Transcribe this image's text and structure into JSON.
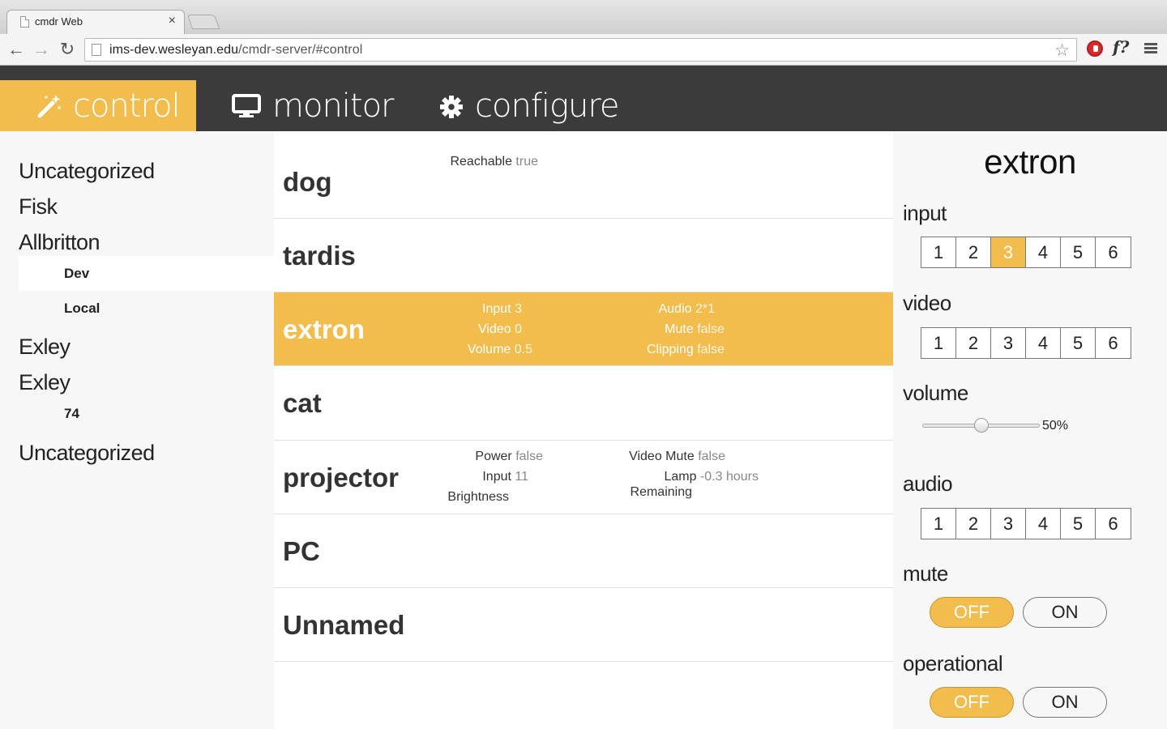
{
  "browser": {
    "tab_title": "cmdr Web",
    "close_glyph": "×",
    "url_host": "ims-dev.wesleyan.edu",
    "url_path": "/cmdr-server/#control",
    "back_glyph": "←",
    "forward_glyph": "→",
    "reload_glyph": "↻",
    "star_glyph": "☆",
    "ext_f_label": "f?"
  },
  "nav": {
    "tabs": [
      {
        "label": "control",
        "icon": "magic-wand-icon",
        "active": true
      },
      {
        "label": "monitor",
        "icon": "monitor-icon",
        "active": false
      },
      {
        "label": "configure",
        "icon": "gear-icon",
        "active": false
      }
    ],
    "accent_color": "#f2bd4d",
    "bar_color": "#3b3b3c"
  },
  "sidebar": {
    "items": [
      {
        "label": "Uncategorized"
      },
      {
        "label": "Fisk"
      },
      {
        "label": "Allbritton",
        "children": [
          "Dev",
          "Local"
        ],
        "selected_child": "Dev"
      },
      {
        "label": "Exley"
      },
      {
        "label": "Exley",
        "children": [
          "74"
        ]
      },
      {
        "label": "Uncategorized"
      }
    ]
  },
  "devices": [
    {
      "name": "dog",
      "props": [
        {
          "k": "Reachable",
          "v": "true"
        }
      ]
    },
    {
      "name": "tardis",
      "props": []
    },
    {
      "name": "extron",
      "selected": true,
      "props": [
        {
          "k": "Input",
          "v": "3"
        },
        {
          "k": "Video",
          "v": "0"
        },
        {
          "k": "Volume",
          "v": "0.5"
        },
        {
          "k": "Audio",
          "v": "2*1"
        },
        {
          "k": "Mute",
          "v": "false"
        },
        {
          "k": "Clipping",
          "v": "false"
        }
      ]
    },
    {
      "name": "cat",
      "props": []
    },
    {
      "name": "projector",
      "props": [
        {
          "k": "Power",
          "v": "false"
        },
        {
          "k": "Input",
          "v": "11"
        },
        {
          "k": "Brightness",
          "v": ""
        },
        {
          "k": "Video Mute",
          "v": "false"
        },
        {
          "k": "Lamp",
          "v": "-0.3 hours"
        },
        {
          "k": "Remaining",
          "v": ""
        }
      ]
    },
    {
      "name": "PC",
      "props": []
    },
    {
      "name": "Unnamed",
      "props": []
    }
  ],
  "panel": {
    "title": "extron",
    "input": {
      "label": "input",
      "options": [
        "1",
        "2",
        "3",
        "4",
        "5",
        "6"
      ],
      "selected": "3"
    },
    "video": {
      "label": "video",
      "options": [
        "1",
        "2",
        "3",
        "4",
        "5",
        "6"
      ],
      "selected": ""
    },
    "volume": {
      "label": "volume",
      "value": 0.5,
      "display": "50%"
    },
    "audio": {
      "label": "audio",
      "options": [
        "1",
        "2",
        "3",
        "4",
        "5",
        "6"
      ],
      "selected": ""
    },
    "mute": {
      "label": "mute",
      "off": "OFF",
      "on": "ON",
      "state": "OFF"
    },
    "operational": {
      "label": "operational",
      "off": "OFF",
      "on": "ON",
      "state": "OFF"
    }
  }
}
